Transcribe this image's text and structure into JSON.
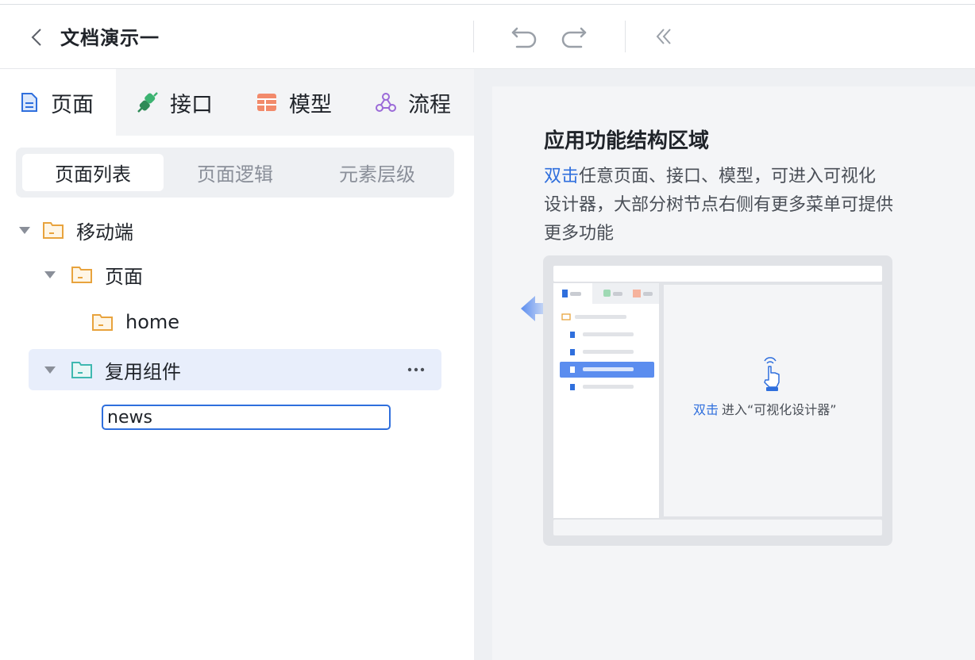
{
  "header": {
    "title": "文档演示一"
  },
  "tabs": [
    {
      "label": "页面",
      "icon": "page-icon"
    },
    {
      "label": "接口",
      "icon": "api-plug-icon"
    },
    {
      "label": "模型",
      "icon": "model-table-icon"
    },
    {
      "label": "流程",
      "icon": "flow-icon"
    }
  ],
  "segment": [
    "页面列表",
    "页面逻辑",
    "元素层级"
  ],
  "tree": {
    "mobile": "移动端",
    "pages": "页面",
    "home": "home",
    "components": "复用组件",
    "rename_value": "news"
  },
  "help": {
    "title": "应用功能结构区域",
    "highlight": "双击",
    "text": "任意页面、接口、模型，可进入可视化设计器，大部分树节点右侧有更多菜单可提供更多功能",
    "illustration_highlight": "双击",
    "illustration_text": "进入“可视化设计器”"
  },
  "colors": {
    "accent": "#2f6fdd",
    "folder": "#e8a33d",
    "folder_teal": "#3fb8b0"
  }
}
